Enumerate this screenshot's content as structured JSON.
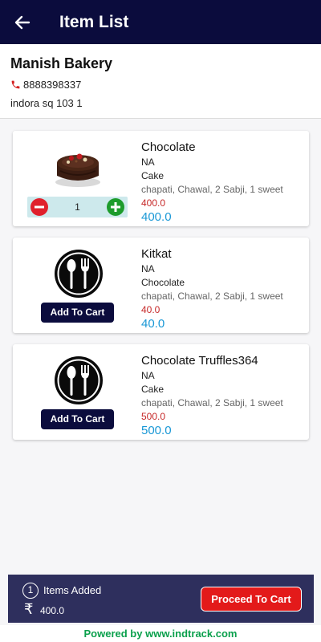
{
  "appbar": {
    "title": "Item List",
    "back_icon": "arrow-left-icon"
  },
  "shop": {
    "name": "Manish Bakery",
    "phone_icon": "phone-icon",
    "phone": "8888398337",
    "address": "indora sq 103 1"
  },
  "items": [
    {
      "name": "Chocolate",
      "line1": "NA",
      "category": "Cake",
      "description": "chapati, Chawal, 2 Sabji, 1 sweet",
      "mrp": "400.0",
      "price": "400.0",
      "image": "cake-image",
      "in_cart": true,
      "quantity": "1"
    },
    {
      "name": "Kitkat",
      "line1": "NA",
      "category": "Chocolate",
      "description": "chapati, Chawal, 2 Sabji, 1 sweet",
      "mrp": "40.0",
      "price": "40.0",
      "image": "dish-icon",
      "in_cart": false,
      "button_label": "Add To Cart"
    },
    {
      "name": "Chocolate Truffles364",
      "line1": "NA",
      "category": "Cake",
      "description": "chapati, Chawal, 2 Sabji, 1 sweet",
      "mrp": "500.0",
      "price": "500.0",
      "image": "dish-icon",
      "in_cart": false,
      "button_label": "Add To Cart"
    }
  ],
  "footer": {
    "count": "1",
    "items_added_label": "Items Added",
    "currency_symbol": "₹",
    "total": "400.0",
    "proceed_label": "Proceed To Cart"
  },
  "powered_by": {
    "prefix": "Powered by ",
    "link": "www.indtrack.com"
  },
  "colors": {
    "appbar": "#0b0c3d",
    "price": "#1a98d6",
    "mrp": "#c62828",
    "footer": "#2e2f5d",
    "proceed": "#e31a1a",
    "powered": "#0aa04c"
  }
}
